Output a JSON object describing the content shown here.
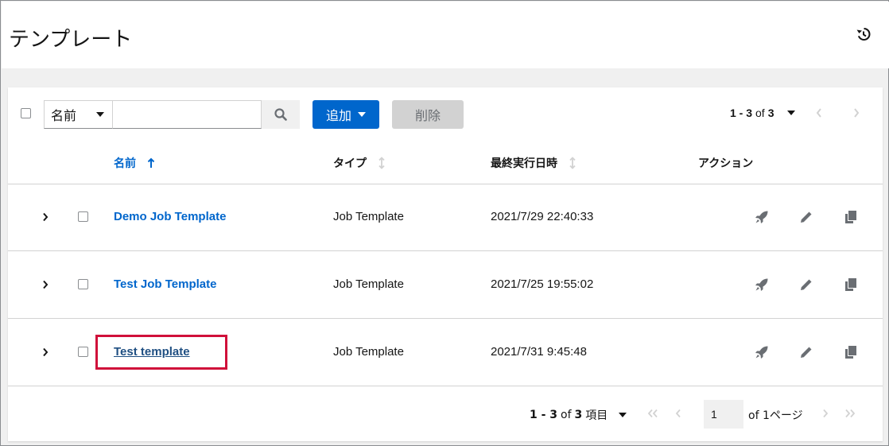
{
  "header": {
    "title": "テンプレート",
    "history_icon": "history-icon"
  },
  "toolbar": {
    "filter_label": "名前",
    "search_value": "",
    "add_label": "追加",
    "delete_label": "削除",
    "range_start": "1 - 3",
    "range_of": "of",
    "range_total": "3"
  },
  "columns": {
    "name": "名前",
    "type": "タイプ",
    "last_run": "最終実行日時",
    "actions": "アクション"
  },
  "rows": [
    {
      "name": "Demo Job Template",
      "type": "Job Template",
      "last_run": "2021/7/29 22:40:33"
    },
    {
      "name": "Test Job Template",
      "type": "Job Template",
      "last_run": "2021/7/25 19:55:02"
    },
    {
      "name": "Test template",
      "type": "Job Template",
      "last_run": "2021/7/31 9:45:48"
    }
  ],
  "pagination": {
    "range": "1 - 3",
    "of": "of",
    "total": "3",
    "items_suffix": "項目",
    "page_value": "1",
    "of_pages": "of 1ページ"
  },
  "colors": {
    "accent": "#0066cc",
    "highlight": "#d0103a"
  }
}
